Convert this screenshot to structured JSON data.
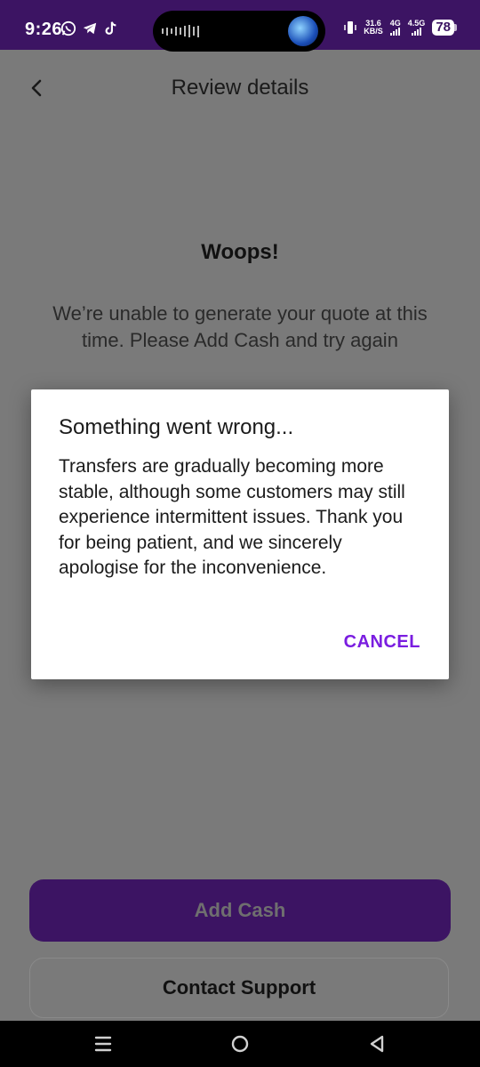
{
  "status_bar": {
    "time": "9:26",
    "net_speed_value": "31.6",
    "net_speed_unit": "KB/S",
    "signal1_label": "4G",
    "signal2_label": "4.5G",
    "battery": "78"
  },
  "header": {
    "title": "Review details"
  },
  "error": {
    "heading": "Woops!",
    "message": "We’re unable to generate your quote at this time. Please Add Cash and try again"
  },
  "dialog": {
    "title": "Something went wrong...",
    "body": "Transfers are gradually becoming more stable, although some customers may still experience intermittent issues. Thank you for being patient, and we sincerely apologise for the inconvenience.",
    "cancel_label": "CANCEL"
  },
  "actions": {
    "add_cash_label": "Add Cash",
    "contact_support_label": "Contact Support"
  },
  "colors": {
    "brand": "#3c1463",
    "accent": "#7a1de0",
    "scrim_background": "#7a7a7a"
  }
}
